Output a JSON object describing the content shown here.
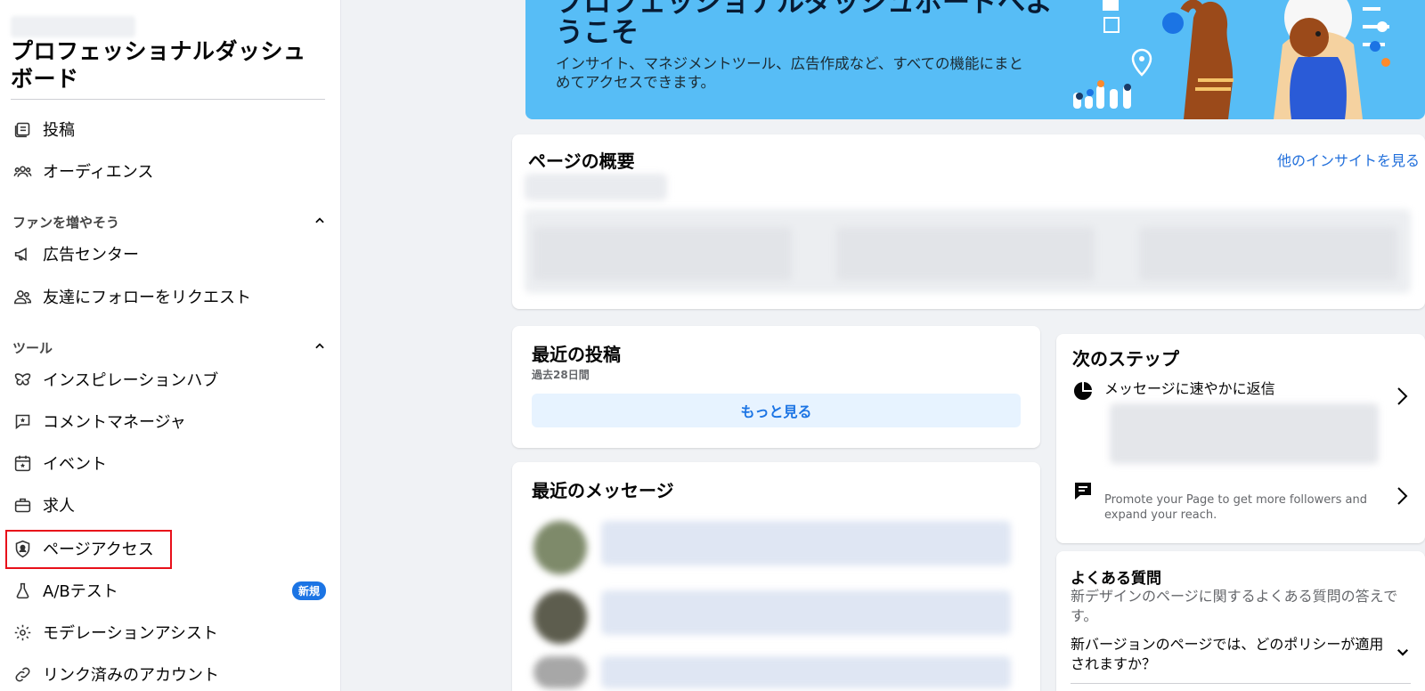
{
  "sidebar": {
    "title": "プロフェッショナルダッシュボード",
    "items_top": [
      {
        "label": "投稿",
        "icon": "posts-icon"
      },
      {
        "label": "オーディエンス",
        "icon": "audience-icon"
      }
    ],
    "section_grow": "ファンを増やそう",
    "items_grow": [
      {
        "label": "広告センター",
        "icon": "megaphone-icon"
      },
      {
        "label": "友達にフォローをリクエスト",
        "icon": "friends-icon"
      }
    ],
    "section_tools": "ツール",
    "items_tools": [
      {
        "label": "インスピレーションハブ",
        "icon": "butterfly-icon"
      },
      {
        "label": "コメントマネージャ",
        "icon": "comment-icon"
      },
      {
        "label": "イベント",
        "icon": "calendar-star-icon"
      },
      {
        "label": "求人",
        "icon": "briefcase-icon"
      },
      {
        "label": "ページアクセス",
        "icon": "shield-user-icon"
      },
      {
        "label": "A/Bテスト",
        "icon": "flask-icon",
        "badge": "新規"
      },
      {
        "label": "モデレーションアシスト",
        "icon": "gear-icon"
      },
      {
        "label": "リンク済みのアカウント",
        "icon": "link-icon"
      }
    ]
  },
  "banner": {
    "title": "プロフェッショナルダッシュボードへようこそ",
    "subtitle": "インサイト、マネジメントツール、広告作成など、すべての機能にまとめてアクセスできます。"
  },
  "overview": {
    "title": "ページの概要",
    "link": "他のインサイトを見る"
  },
  "recent_posts": {
    "title": "最近の投稿",
    "period": "過去28日間",
    "more_button": "もっと見る"
  },
  "recent_messages": {
    "title": "最近のメッセージ"
  },
  "next_steps": {
    "title": "次のステップ",
    "items": [
      {
        "label": "メッセージに速やかに返信",
        "icon": "pie-icon"
      },
      {
        "label": "Promote your Page to get more followers and expand your reach.",
        "icon": "chat-icon"
      }
    ]
  },
  "faq": {
    "title": "よくある質問",
    "subtitle": "新デザインのページに関するよくある質問の答えです。",
    "question": "新バージョンのページでは、どのポリシーが適用されますか？"
  },
  "colors": {
    "accent": "#1b74e4",
    "banner": "#57bdf6",
    "highlight": "#e8101a"
  }
}
